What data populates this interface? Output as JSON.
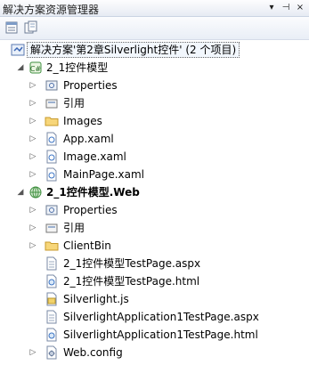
{
  "window": {
    "title": "解决方案资源管理器",
    "controls": [
      "▾",
      "⊣",
      "×"
    ]
  },
  "toolbar": {
    "buttons": [
      {
        "name": "properties-icon"
      },
      {
        "name": "show-all-files-icon"
      }
    ]
  },
  "tree": {
    "solution": "解决方案'第2章Silverlight控件' (2 个项目)",
    "project1": {
      "label": "2_1控件模型",
      "items": [
        {
          "label": "Properties",
          "icon": "properties-folder-icon",
          "expandable": true
        },
        {
          "label": "引用",
          "icon": "references-icon",
          "expandable": true
        },
        {
          "label": "Images",
          "icon": "folder-icon",
          "expandable": true
        },
        {
          "label": "App.xaml",
          "icon": "xaml-file-icon",
          "expandable": true
        },
        {
          "label": "Image.xaml",
          "icon": "xaml-file-icon",
          "expandable": true
        },
        {
          "label": "MainPage.xaml",
          "icon": "xaml-file-icon",
          "expandable": true
        }
      ]
    },
    "project2": {
      "label": "2_1控件模型.Web",
      "items": [
        {
          "label": "Properties",
          "icon": "properties-folder-icon",
          "expandable": true
        },
        {
          "label": "引用",
          "icon": "references-icon",
          "expandable": true
        },
        {
          "label": "ClientBin",
          "icon": "folder-icon",
          "expandable": true
        },
        {
          "label": "2_1控件模型TestPage.aspx",
          "icon": "aspx-file-icon",
          "expandable": false
        },
        {
          "label": "2_1控件模型TestPage.html",
          "icon": "html-file-icon",
          "expandable": false
        },
        {
          "label": "Silverlight.js",
          "icon": "js-file-icon",
          "expandable": false
        },
        {
          "label": "SilverlightApplication1TestPage.aspx",
          "icon": "aspx-file-icon",
          "expandable": false
        },
        {
          "label": "SilverlightApplication1TestPage.html",
          "icon": "html-file-icon",
          "expandable": false
        },
        {
          "label": "Web.config",
          "icon": "config-file-icon",
          "expandable": true
        }
      ]
    }
  }
}
